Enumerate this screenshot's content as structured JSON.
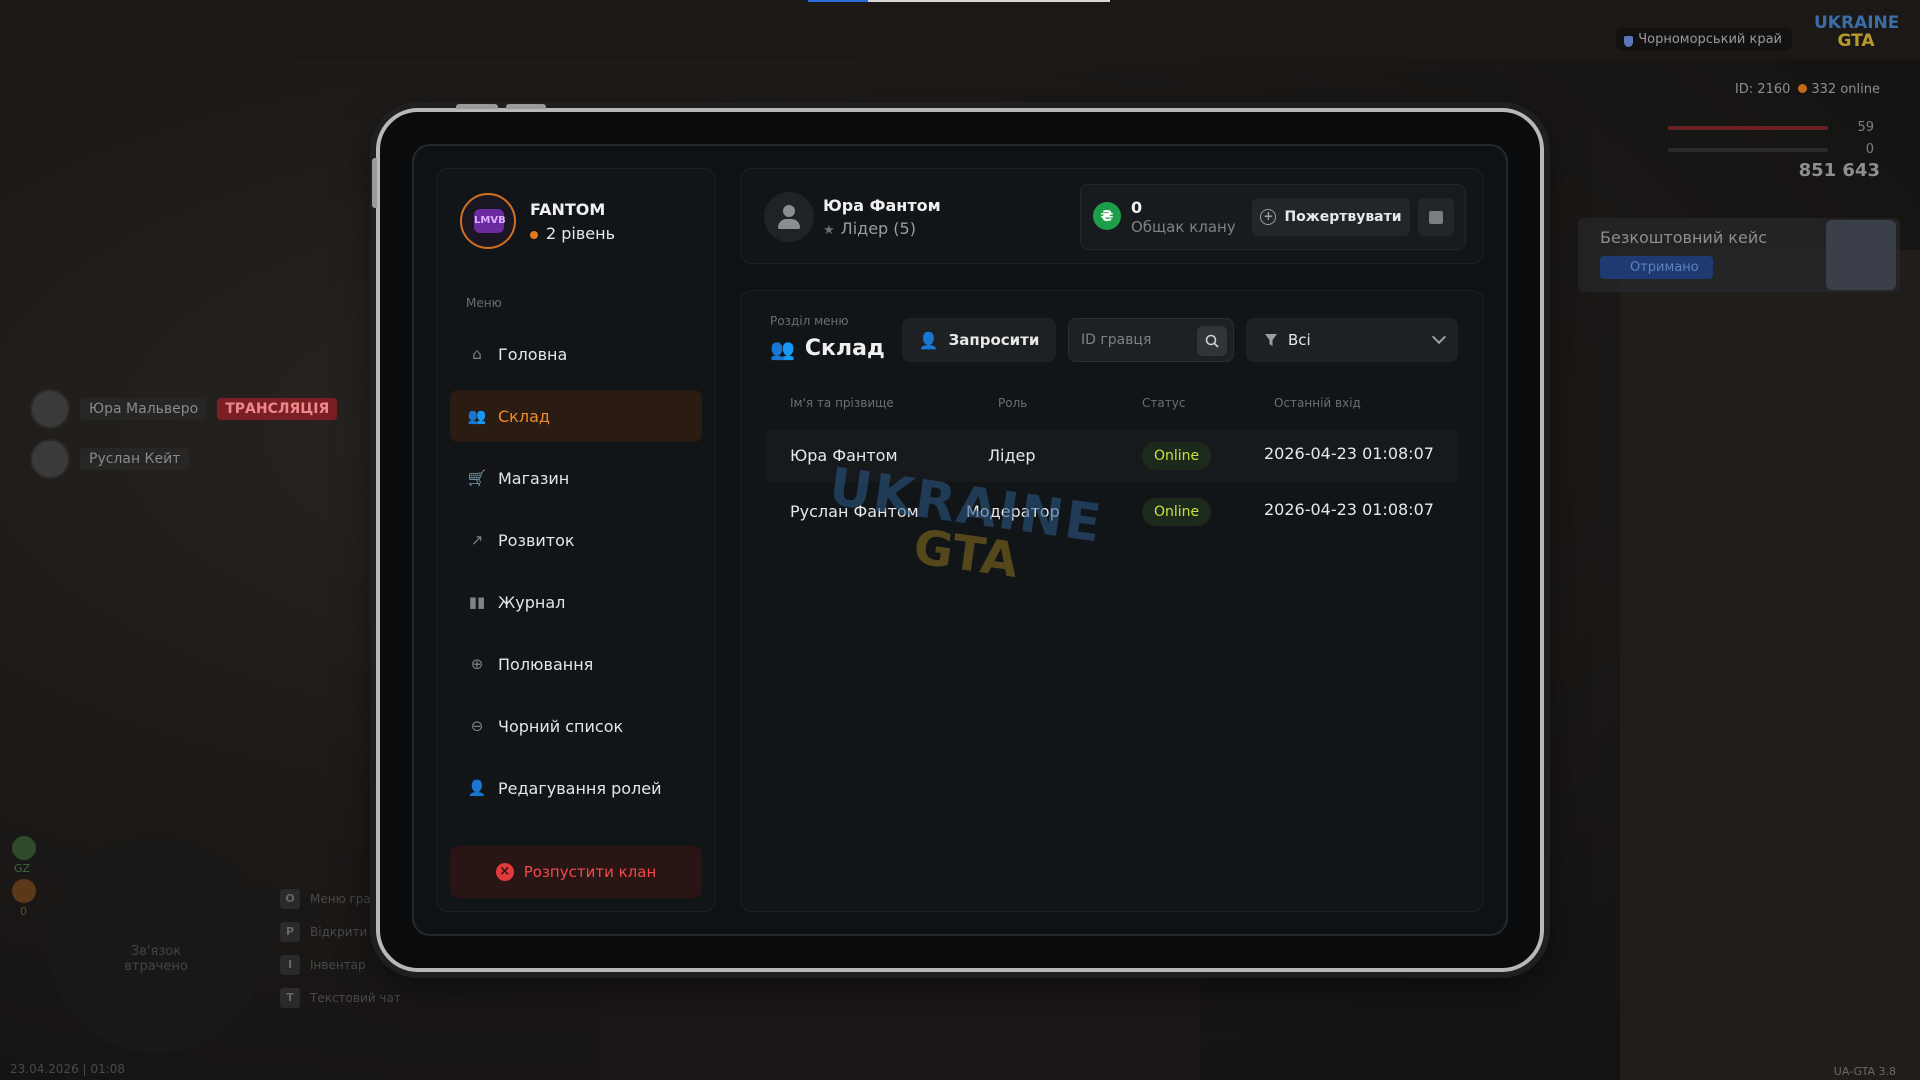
{
  "hud": {
    "region": "Чорноморський край",
    "logo_top": "UKRAINE",
    "logo_bottom": "GTA",
    "id_text": "ID: 2160",
    "online_text": "332 online",
    "health": "59",
    "armor": "0",
    "money": "851 643",
    "case_title": "Безкоштовний кейс",
    "case_status": "Отримано",
    "version": "UA-GTA 3.8",
    "datetime": "23.04.2026 | 01:08"
  },
  "voice_list": [
    {
      "name": "Юра Мальверо",
      "badge": "ТРАНСЛЯЦІЯ"
    },
    {
      "name": "Руслан Кейт",
      "badge": ""
    }
  ],
  "minimap": {
    "text_line1": "Зв'язок",
    "text_line2": "втрачено",
    "gz_label": "GZ",
    "zero": "0"
  },
  "hotkeys": [
    {
      "key": "O",
      "label": "Меню гра"
    },
    {
      "key": "P",
      "label": "Відкрити"
    },
    {
      "key": "I",
      "label": "Інвентар"
    },
    {
      "key": "T",
      "label": "Текстовий чат"
    }
  ],
  "clan": {
    "logo_text": "LMVB",
    "name": "FANTOM",
    "level": "2 рівень"
  },
  "menu": {
    "caption": "Меню",
    "items": [
      {
        "label": "Головна",
        "icon": "home-icon"
      },
      {
        "label": "Склад",
        "icon": "people-icon",
        "active": true
      },
      {
        "label": "Магазин",
        "icon": "basket-icon"
      },
      {
        "label": "Розвиток",
        "icon": "chart-icon"
      },
      {
        "label": "Журнал",
        "icon": "book-icon"
      },
      {
        "label": "Полювання",
        "icon": "crosshair-icon"
      },
      {
        "label": "Чорний список",
        "icon": "minus-circle-icon"
      },
      {
        "label": "Редагування ролей",
        "icon": "user-edit-icon"
      }
    ],
    "disband_label": "Розпустити клан"
  },
  "header": {
    "user_name": "Юра Фантом",
    "user_role": "Лідер (5)",
    "treasury_value": "0",
    "treasury_label": "Общак клану",
    "donate_label": "Пожертвувати"
  },
  "section": {
    "caption": "Розділ меню",
    "title": "Склад",
    "invite_label": "Запросити",
    "search_placeholder": "ID гравця",
    "filter_value": "Всі"
  },
  "table": {
    "headers": [
      "Ім'я та прізвище",
      "Роль",
      "Статус",
      "Останній вхід"
    ],
    "rows": [
      {
        "name": "Юра Фантом",
        "role": "Лідер",
        "status": "Online",
        "last_login": "2026-04-23 01:08:07"
      },
      {
        "name": "Руслан Фантом",
        "role": "Модератор",
        "status": "Online",
        "last_login": "2026-04-23 01:08:07"
      }
    ]
  },
  "watermark": {
    "top": "UKRAINE",
    "bottom": "GTA"
  }
}
